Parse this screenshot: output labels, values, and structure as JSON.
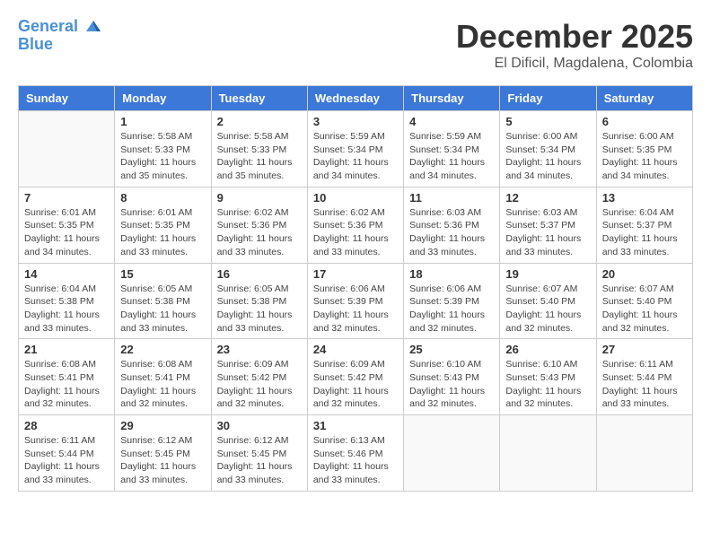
{
  "logo": {
    "line1": "General",
    "line2": "Blue"
  },
  "title": {
    "month": "December 2025",
    "location": "El Dificil, Magdalena, Colombia"
  },
  "weekdays": [
    "Sunday",
    "Monday",
    "Tuesday",
    "Wednesday",
    "Thursday",
    "Friday",
    "Saturday"
  ],
  "weeks": [
    [
      {
        "day": "",
        "info": ""
      },
      {
        "day": "1",
        "info": "Sunrise: 5:58 AM\nSunset: 5:33 PM\nDaylight: 11 hours\nand 35 minutes."
      },
      {
        "day": "2",
        "info": "Sunrise: 5:58 AM\nSunset: 5:33 PM\nDaylight: 11 hours\nand 35 minutes."
      },
      {
        "day": "3",
        "info": "Sunrise: 5:59 AM\nSunset: 5:34 PM\nDaylight: 11 hours\nand 34 minutes."
      },
      {
        "day": "4",
        "info": "Sunrise: 5:59 AM\nSunset: 5:34 PM\nDaylight: 11 hours\nand 34 minutes."
      },
      {
        "day": "5",
        "info": "Sunrise: 6:00 AM\nSunset: 5:34 PM\nDaylight: 11 hours\nand 34 minutes."
      },
      {
        "day": "6",
        "info": "Sunrise: 6:00 AM\nSunset: 5:35 PM\nDaylight: 11 hours\nand 34 minutes."
      }
    ],
    [
      {
        "day": "7",
        "info": "Sunrise: 6:01 AM\nSunset: 5:35 PM\nDaylight: 11 hours\nand 34 minutes."
      },
      {
        "day": "8",
        "info": "Sunrise: 6:01 AM\nSunset: 5:35 PM\nDaylight: 11 hours\nand 33 minutes."
      },
      {
        "day": "9",
        "info": "Sunrise: 6:02 AM\nSunset: 5:36 PM\nDaylight: 11 hours\nand 33 minutes."
      },
      {
        "day": "10",
        "info": "Sunrise: 6:02 AM\nSunset: 5:36 PM\nDaylight: 11 hours\nand 33 minutes."
      },
      {
        "day": "11",
        "info": "Sunrise: 6:03 AM\nSunset: 5:36 PM\nDaylight: 11 hours\nand 33 minutes."
      },
      {
        "day": "12",
        "info": "Sunrise: 6:03 AM\nSunset: 5:37 PM\nDaylight: 11 hours\nand 33 minutes."
      },
      {
        "day": "13",
        "info": "Sunrise: 6:04 AM\nSunset: 5:37 PM\nDaylight: 11 hours\nand 33 minutes."
      }
    ],
    [
      {
        "day": "14",
        "info": "Sunrise: 6:04 AM\nSunset: 5:38 PM\nDaylight: 11 hours\nand 33 minutes."
      },
      {
        "day": "15",
        "info": "Sunrise: 6:05 AM\nSunset: 5:38 PM\nDaylight: 11 hours\nand 33 minutes."
      },
      {
        "day": "16",
        "info": "Sunrise: 6:05 AM\nSunset: 5:38 PM\nDaylight: 11 hours\nand 33 minutes."
      },
      {
        "day": "17",
        "info": "Sunrise: 6:06 AM\nSunset: 5:39 PM\nDaylight: 11 hours\nand 32 minutes."
      },
      {
        "day": "18",
        "info": "Sunrise: 6:06 AM\nSunset: 5:39 PM\nDaylight: 11 hours\nand 32 minutes."
      },
      {
        "day": "19",
        "info": "Sunrise: 6:07 AM\nSunset: 5:40 PM\nDaylight: 11 hours\nand 32 minutes."
      },
      {
        "day": "20",
        "info": "Sunrise: 6:07 AM\nSunset: 5:40 PM\nDaylight: 11 hours\nand 32 minutes."
      }
    ],
    [
      {
        "day": "21",
        "info": "Sunrise: 6:08 AM\nSunset: 5:41 PM\nDaylight: 11 hours\nand 32 minutes."
      },
      {
        "day": "22",
        "info": "Sunrise: 6:08 AM\nSunset: 5:41 PM\nDaylight: 11 hours\nand 32 minutes."
      },
      {
        "day": "23",
        "info": "Sunrise: 6:09 AM\nSunset: 5:42 PM\nDaylight: 11 hours\nand 32 minutes."
      },
      {
        "day": "24",
        "info": "Sunrise: 6:09 AM\nSunset: 5:42 PM\nDaylight: 11 hours\nand 32 minutes."
      },
      {
        "day": "25",
        "info": "Sunrise: 6:10 AM\nSunset: 5:43 PM\nDaylight: 11 hours\nand 32 minutes."
      },
      {
        "day": "26",
        "info": "Sunrise: 6:10 AM\nSunset: 5:43 PM\nDaylight: 11 hours\nand 32 minutes."
      },
      {
        "day": "27",
        "info": "Sunrise: 6:11 AM\nSunset: 5:44 PM\nDaylight: 11 hours\nand 33 minutes."
      }
    ],
    [
      {
        "day": "28",
        "info": "Sunrise: 6:11 AM\nSunset: 5:44 PM\nDaylight: 11 hours\nand 33 minutes."
      },
      {
        "day": "29",
        "info": "Sunrise: 6:12 AM\nSunset: 5:45 PM\nDaylight: 11 hours\nand 33 minutes."
      },
      {
        "day": "30",
        "info": "Sunrise: 6:12 AM\nSunset: 5:45 PM\nDaylight: 11 hours\nand 33 minutes."
      },
      {
        "day": "31",
        "info": "Sunrise: 6:13 AM\nSunset: 5:46 PM\nDaylight: 11 hours\nand 33 minutes."
      },
      {
        "day": "",
        "info": ""
      },
      {
        "day": "",
        "info": ""
      },
      {
        "day": "",
        "info": ""
      }
    ]
  ]
}
